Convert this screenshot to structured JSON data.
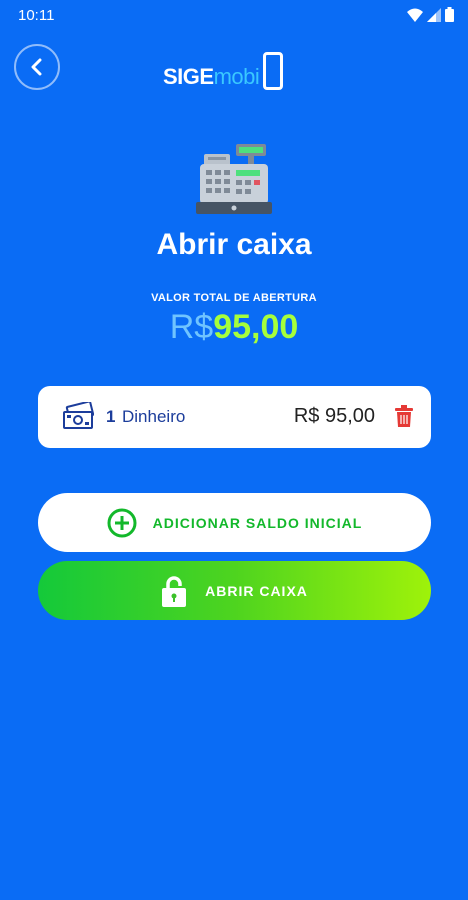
{
  "status": {
    "time": "10:11"
  },
  "header": {
    "logo_sige": "SIGE",
    "logo_mobi": "mobi"
  },
  "main": {
    "title": "Abrir caixa",
    "total_label": "VALOR TOTAL DE ABERTURA",
    "total_currency": "R$",
    "total_amount": "95,00"
  },
  "entries": [
    {
      "qty": "1",
      "name": "Dinheiro",
      "amount": "R$ 95,00"
    }
  ],
  "actions": {
    "add_label": "ADICIONAR SALDO INICIAL",
    "open_label": "ABRIR CAIXA"
  },
  "colors": {
    "background": "#0a6cf5",
    "accent_green": "#13b82b",
    "total_green": "#a6ff3b",
    "delete_red": "#e53935"
  },
  "icons": [
    "back-arrow-icon",
    "cash-register-icon",
    "money-icon",
    "trash-icon",
    "plus-circle-icon",
    "lock-icon",
    "wifi-icon",
    "signal-icon",
    "battery-icon"
  ]
}
